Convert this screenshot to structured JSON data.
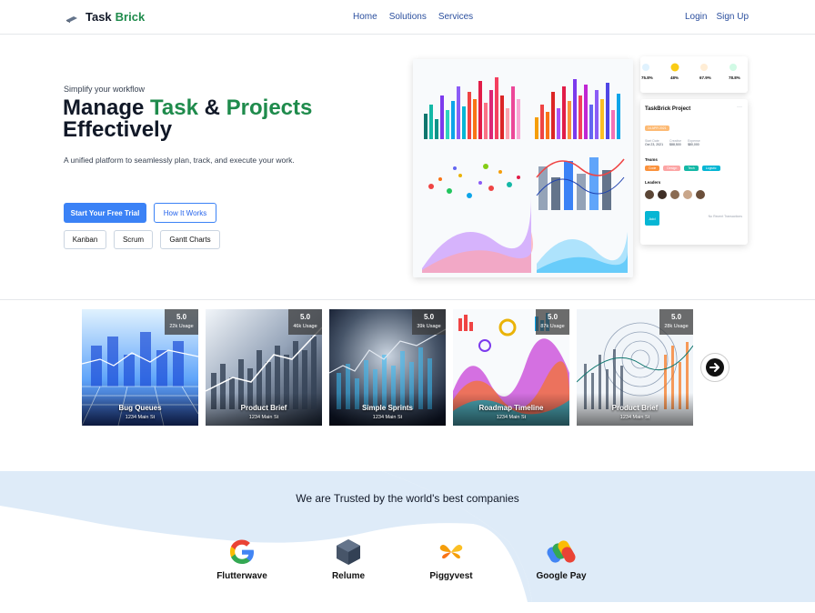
{
  "nav": {
    "brand_part1": "Task",
    "brand_part2": "Brick",
    "links": [
      "Home",
      "Solutions",
      "Services"
    ],
    "login": "Login",
    "signup": "Sign Up"
  },
  "hero": {
    "subtitle": "Simplify your workflow",
    "title_word1": "Manage",
    "title_word2": "Task",
    "title_amp": "&",
    "title_word3": "Projects",
    "title_line2": "Effectively",
    "description": "A unified platform to seamlessly plan, track, and execute your work.",
    "cta_primary": "Start Your Free Trial",
    "cta_secondary": "How It Works",
    "chips": [
      "Kanban",
      "Scrum",
      "Gantt Charts"
    ]
  },
  "preview": {
    "stats": [
      "75.8%",
      "48%",
      "67.9%",
      "78.8%"
    ],
    "project_title": "TaskBrick Project",
    "date_badge": "14 APR 2021",
    "fields": [
      {
        "label": "Start Date",
        "value": "Oct 23, 2021"
      },
      {
        "label": "Creative",
        "value": "$88,500"
      },
      {
        "label": "Expense",
        "value": "$80,000"
      }
    ],
    "teams_label": "Teams",
    "teams": [
      "Code",
      "Design",
      "Tech",
      "Logistic"
    ],
    "leaders_label": "Leaders",
    "add_button": "Add",
    "no_transactions": "No Recent Transactions"
  },
  "cards": [
    {
      "name": "Bug Queues",
      "address": "1234 Main St",
      "rating": "5.0",
      "usage": "22k Usage"
    },
    {
      "name": "Product Brief",
      "address": "1234 Main St",
      "rating": "5.0",
      "usage": "46k Usage"
    },
    {
      "name": "Simple Sprints",
      "address": "1234 Main St",
      "rating": "5.0",
      "usage": "39k Usage"
    },
    {
      "name": "Roadmap Timeline",
      "address": "1234 Main St",
      "rating": "5.0",
      "usage": "87k Usage"
    },
    {
      "name": "Product Brief",
      "address": "1234 Main St",
      "rating": "5.0",
      "usage": "28k Usage"
    }
  ],
  "trusted": {
    "title": "We are Trusted by the world's best companies",
    "companies": [
      "Flutterwave",
      "Relume",
      "Piggyvest",
      "Google Pay"
    ]
  },
  "colors": {
    "accent_green": "#1f8b4c",
    "primary_blue": "#3b82f6",
    "wave_blue": "#deebf8"
  }
}
